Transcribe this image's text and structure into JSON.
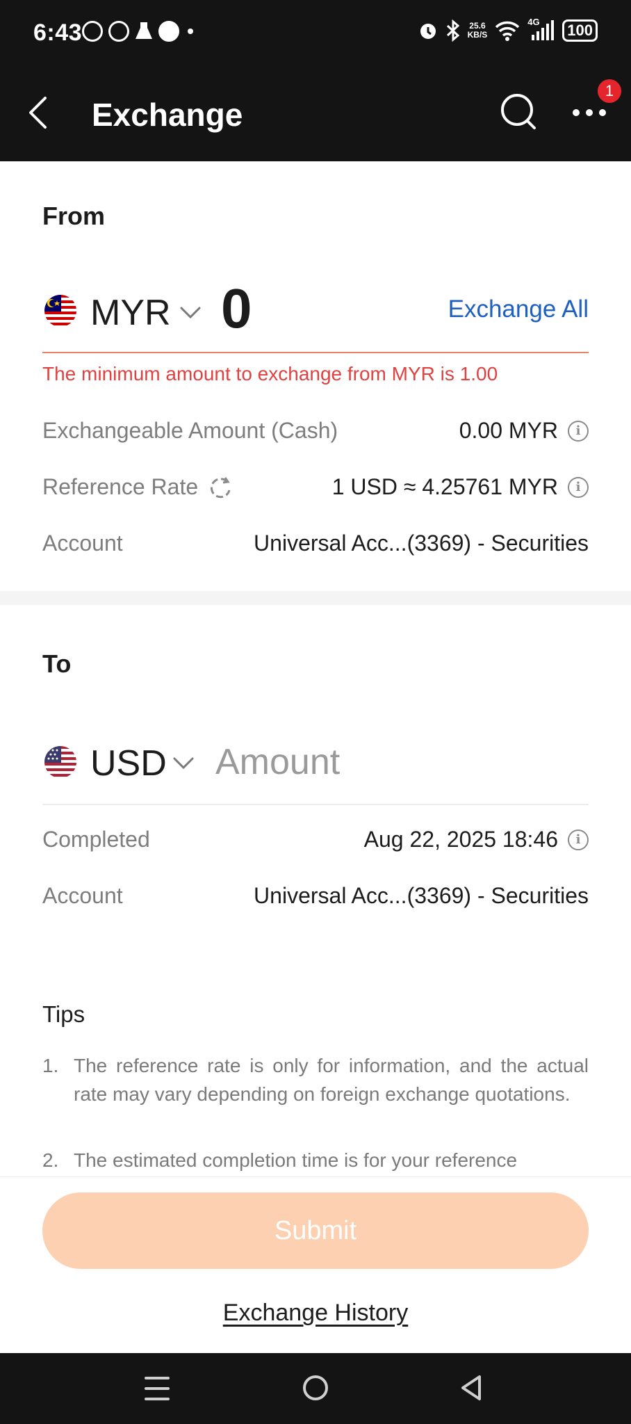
{
  "status_bar": {
    "time": "6:43",
    "net_speed_top": "25.6",
    "net_speed_bottom": "KB/S",
    "network": "4G",
    "battery": "100"
  },
  "header": {
    "title": "Exchange",
    "notification_count": "1"
  },
  "from": {
    "section_title": "From",
    "currency": "MYR",
    "amount": "0",
    "exchange_all": "Exchange All",
    "error": "The minimum amount to exchange from MYR is 1.00",
    "rows": {
      "exchangeable_label": "Exchangeable Amount (Cash)",
      "exchangeable_value": "0.00 MYR",
      "rate_label": "Reference Rate",
      "rate_value": "1 USD ≈ 4.25761 MYR",
      "account_label": "Account",
      "account_value": "Universal Acc...(3369) - Securities"
    }
  },
  "to": {
    "section_title": "To",
    "currency": "USD",
    "amount_placeholder": "Amount",
    "rows": {
      "completed_label": "Completed",
      "completed_value": "Aug 22, 2025 18:46",
      "account_label": "Account",
      "account_value": "Universal Acc...(3369) - Securities"
    }
  },
  "tips": {
    "title": "Tips",
    "items": [
      {
        "num": "1.",
        "text": "The reference rate is only for information, and the actual rate may vary depending on foreign exchange quotations."
      },
      {
        "num": "2.",
        "text": "The estimated completion time is for your reference"
      }
    ]
  },
  "actions": {
    "submit": "Submit",
    "history": "Exchange History"
  },
  "colors": {
    "accent_disabled": "#fdd0b1",
    "link_blue": "#1e5fc2",
    "error_red": "#e04141"
  }
}
